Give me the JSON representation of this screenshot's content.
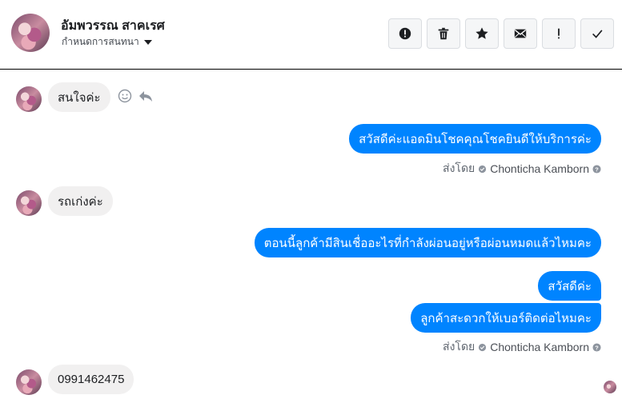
{
  "header": {
    "contact_name": "อัมพวรรณ สาคเรศ",
    "subtitle": "กำหนดการสนทนา",
    "actions": [
      {
        "name": "report-button",
        "icon": "alert-circle-icon"
      },
      {
        "name": "delete-button",
        "icon": "trash-icon"
      },
      {
        "name": "star-button",
        "icon": "star-icon"
      },
      {
        "name": "mail-button",
        "icon": "mail-icon"
      },
      {
        "name": "important-button",
        "icon": "exclamation-icon"
      },
      {
        "name": "done-button",
        "icon": "check-icon"
      }
    ]
  },
  "messages": [
    {
      "direction": "in",
      "text": "สนใจค่ะ"
    },
    {
      "direction": "out",
      "text": "สวัสดีค่ะแอดมินโชคคุณโชคยินดีให้บริการค่ะ"
    },
    {
      "direction": "in",
      "text": "รถเก่งค่ะ"
    },
    {
      "direction": "out",
      "text": "ตอนนี้ลูกค้ามีสินเชื่ออะไรที่กำลังผ่อนอยู่หรือผ่อนหมดแล้วไหมคะ"
    },
    {
      "direction": "out",
      "text": "สวัสดีค่ะ"
    },
    {
      "direction": "out",
      "text": "ลูกค้าสะดวกให้เบอร์ติดต่อไหมคะ"
    },
    {
      "direction": "in",
      "text": "0991462475"
    }
  ],
  "sent_by": {
    "label": "ส่งโดย",
    "agent": "Chonticha Kamborn"
  },
  "colors": {
    "outgoing": "#0084ff",
    "incoming": "#f1f0f0"
  }
}
